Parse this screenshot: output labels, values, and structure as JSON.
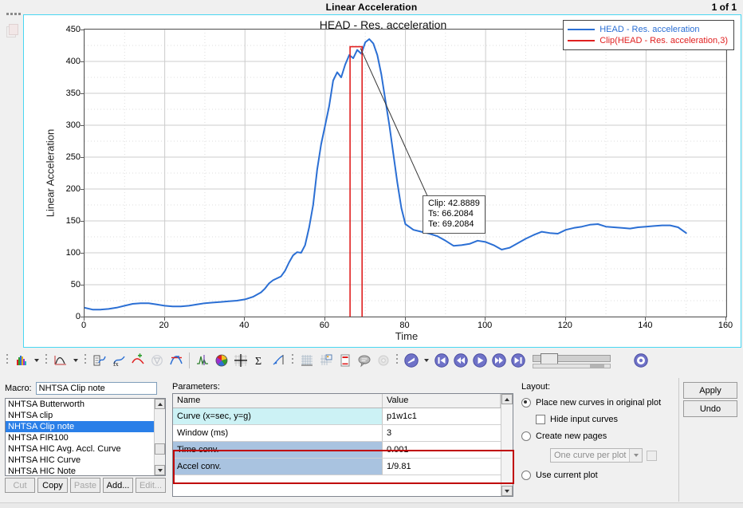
{
  "window": {
    "title": "Linear Acceleration",
    "page_indicator": "1 of 1"
  },
  "plot": {
    "title": "HEAD - Res. acceleration",
    "legend": [
      {
        "label": "HEAD - Res. acceleration",
        "color": "#2b6fd4"
      },
      {
        "label": "Clip(HEAD - Res. acceleration,3)",
        "color": "#e02020"
      }
    ],
    "annotation": {
      "clip": "Clip: 42.8889",
      "ts": "Ts: 66.2084",
      "te": "Te: 69.2084"
    }
  },
  "chart_data": {
    "type": "line",
    "title": "HEAD - Res. acceleration",
    "xlabel": "Time",
    "ylabel": "Linear Acceleration",
    "xlim": [
      0,
      160
    ],
    "ylim": [
      0,
      450
    ],
    "xticks": [
      0,
      20,
      40,
      60,
      80,
      100,
      120,
      140,
      160
    ],
    "yticks": [
      0,
      50,
      100,
      150,
      200,
      250,
      300,
      350,
      400,
      450
    ],
    "grid": true,
    "legend_position": "top-right",
    "series": [
      {
        "name": "HEAD - Res. acceleration",
        "color": "#2b6fd4",
        "x": [
          0,
          2,
          4,
          6,
          8,
          10,
          12,
          14,
          16,
          18,
          20,
          22,
          24,
          26,
          28,
          30,
          32,
          34,
          36,
          38,
          40,
          42,
          44,
          45,
          46,
          47,
          48,
          49,
          50,
          51,
          52,
          53,
          54,
          55,
          56,
          57,
          58,
          59,
          60,
          61,
          62,
          63,
          64,
          65,
          66,
          67,
          68,
          69,
          70,
          71,
          72,
          73,
          74,
          75,
          76,
          77,
          78,
          79,
          80,
          82,
          84,
          86,
          88,
          90,
          92,
          94,
          96,
          98,
          100,
          102,
          104,
          106,
          108,
          110,
          112,
          114,
          116,
          118,
          120,
          122,
          124,
          126,
          128,
          130,
          132,
          134,
          136,
          138,
          140,
          142,
          144,
          146,
          148,
          150
        ],
        "y": [
          14,
          11,
          11,
          12,
          14,
          17,
          20,
          21,
          21,
          19,
          17,
          16,
          16,
          17,
          19,
          21,
          22,
          23,
          24,
          25,
          27,
          31,
          38,
          44,
          52,
          57,
          60,
          63,
          72,
          85,
          96,
          101,
          100,
          112,
          140,
          175,
          230,
          270,
          300,
          330,
          370,
          383,
          375,
          395,
          410,
          405,
          418,
          412,
          430,
          435,
          428,
          410,
          380,
          340,
          300,
          255,
          210,
          170,
          145,
          136,
          133,
          130,
          126,
          119,
          111,
          112,
          114,
          119,
          117,
          112,
          105,
          108,
          115,
          122,
          128,
          133,
          131,
          130,
          136,
          139,
          141,
          144,
          145,
          141,
          140,
          139,
          138,
          140,
          141,
          142,
          143,
          143,
          140,
          131
        ]
      },
      {
        "name": "Clip(HEAD - Res. acceleration,3)",
        "color": "#e02020",
        "clip_level": 423,
        "t_start": 66.2084,
        "t_end": 69.2084
      }
    ]
  },
  "toolbar": {
    "icons": [
      "histogram-icon",
      "line-plot-icon",
      "compute-icon",
      "function-icon",
      "smooth-curve-icon",
      "filter-icon",
      "clip-curve-icon",
      "peak-icon",
      "color-wheel-icon",
      "axes-icon",
      "sigma-icon",
      "derivative-icon",
      "grid-icon",
      "grid-label-icon",
      "report-icon",
      "comment-icon",
      "settings-gear-icon",
      "play-menu-icon",
      "skip-start-icon",
      "rewind-icon",
      "play-icon",
      "fast-forward-icon",
      "skip-end-icon",
      "options-gear-icon"
    ]
  },
  "macro": {
    "label": "Macro:",
    "value": "NHTSA Clip note",
    "items": [
      {
        "label": "NHTSA Butterworth",
        "selected": false
      },
      {
        "label": "NHTSA clip",
        "selected": false
      },
      {
        "label": "NHTSA Clip note",
        "selected": true
      },
      {
        "label": "NHTSA FIR100",
        "selected": false
      },
      {
        "label": "NHTSA HIC Avg. Accl. Curve",
        "selected": false
      },
      {
        "label": "NHTSA HIC Curve",
        "selected": false
      },
      {
        "label": "NHTSA HIC Note",
        "selected": false
      }
    ],
    "buttons": [
      {
        "label": "Cut",
        "enabled": false
      },
      {
        "label": "Copy",
        "enabled": true
      },
      {
        "label": "Paste",
        "enabled": false
      },
      {
        "label": "Add...",
        "enabled": true
      },
      {
        "label": "Edit...",
        "enabled": false
      }
    ]
  },
  "parameters": {
    "label": "Parameters:",
    "columns": [
      "Name",
      "Value"
    ],
    "rows": [
      {
        "name": "Curve (x=sec, y=g)",
        "value": "p1w1c1",
        "highlight": "cyan"
      },
      {
        "name": "Window (ms)",
        "value": "3",
        "highlight": "none"
      },
      {
        "name": "Time conv.",
        "value": "0.001",
        "highlight": "blue"
      },
      {
        "name": "Accel conv.",
        "value": "1/9.81",
        "highlight": "blue"
      }
    ],
    "highlight_color": "#c00000"
  },
  "layout": {
    "label": "Layout:",
    "options": [
      {
        "label": "Place new curves in original plot",
        "selected": true
      },
      {
        "label": "Create new pages",
        "selected": false
      },
      {
        "label": "Use current plot",
        "selected": false
      }
    ],
    "hide_input_curves": {
      "label": "Hide input curves",
      "checked": false
    },
    "page_mode": "One curve per plot"
  },
  "actions": {
    "apply": "Apply",
    "undo": "Undo"
  }
}
